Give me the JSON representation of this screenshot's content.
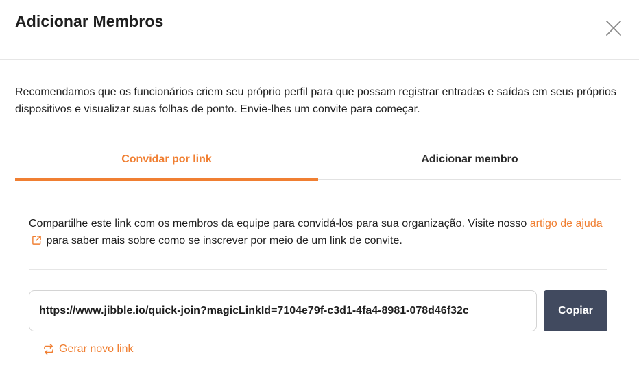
{
  "dialog": {
    "title": "Adicionar Membros",
    "close_icon": "close-icon",
    "intro": "Recomendamos que os funcionários criem seu próprio perfil para que possam registrar entradas e saídas em seus próprios dispositivos e visualizar suas folhas de ponto. Envie-lhes um convite para começar."
  },
  "tabs": [
    {
      "label": "Convidar por link",
      "active": true
    },
    {
      "label": "Adicionar membro",
      "active": false
    }
  ],
  "invite": {
    "text_before": "Compartilhe este link com os membros da equipe para convidá-los para sua organização. Visite nosso ",
    "help_link": "artigo de ajuda",
    "help_icon": "external-link-icon",
    "text_after": " para saber mais sobre como se inscrever por meio de um link de convite.",
    "link_value": "https://www.jibble.io/quick-join?magicLinkId=7104e79f-c3d1-4fa4-8981-078d46f32c",
    "copy_label": "Copiar",
    "regenerate_label": "Gerar novo link",
    "regenerate_icon": "refresh-icon"
  },
  "colors": {
    "accent": "#f07f32",
    "button_bg": "#414a5f"
  }
}
